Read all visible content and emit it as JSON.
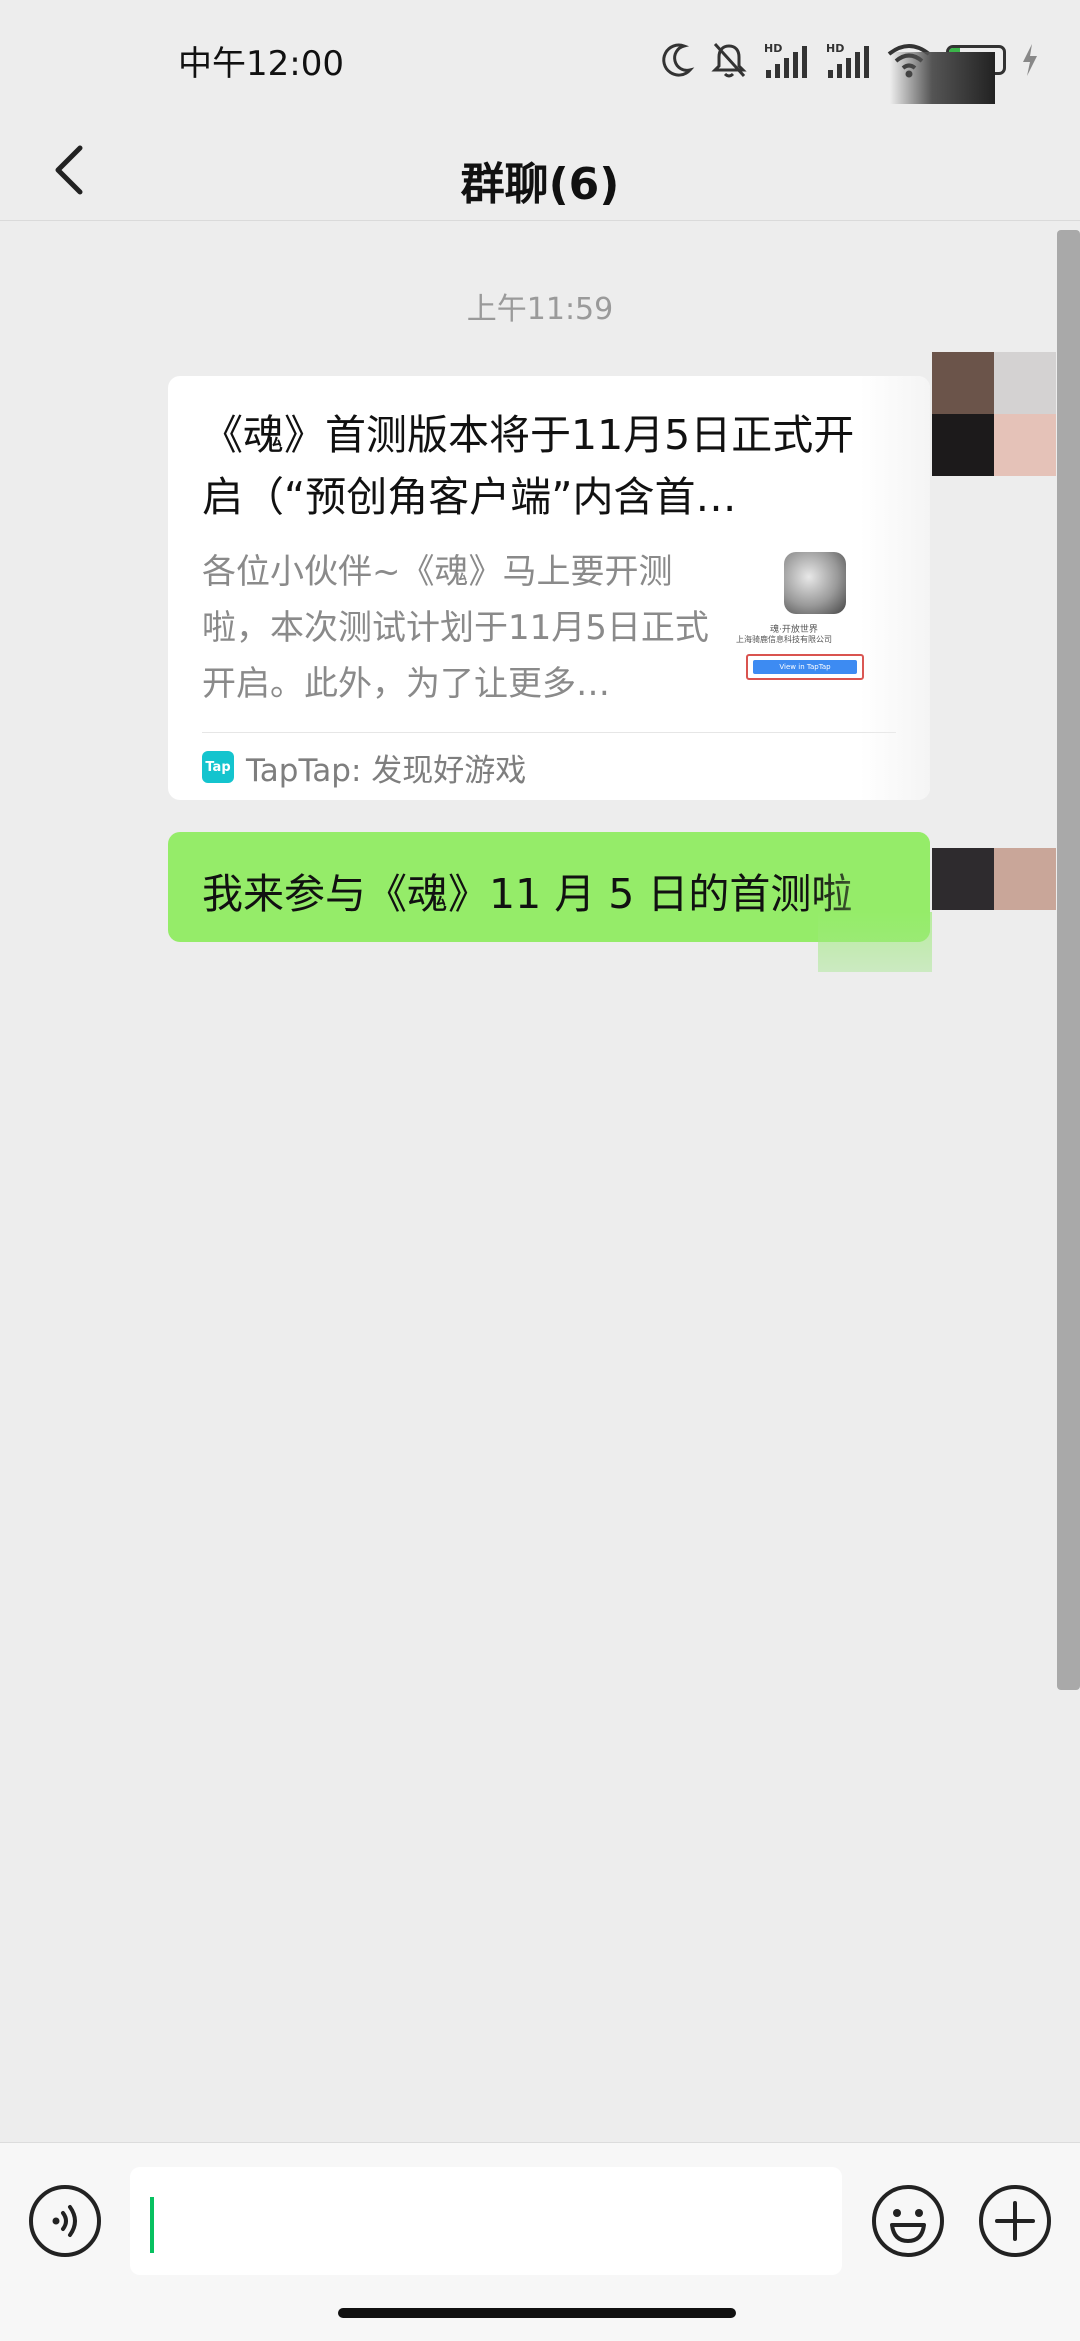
{
  "status_bar": {
    "time": "中午12:00",
    "icons": [
      "moon-icon",
      "bell-off-icon",
      "signal-hd-icon",
      "signal-hd-icon",
      "wifi-icon",
      "battery-icon",
      "charging-bolt-icon"
    ],
    "battery_level": "17",
    "hd_label": "HD"
  },
  "nav": {
    "title": "群聊(6)",
    "back_icon": "chevron-left-icon"
  },
  "chat": {
    "timestamp": "上午11:59",
    "link_card": {
      "title": "《魂》首测版本将于11月5日正式开启（“预创角客户端”内含首…",
      "description": "各位小伙伴~《魂》马上要开测啦，本次测试计划于11月5日正式开启。此外，为了让更多…",
      "thumbnail": {
        "caption": "魂·开放世界",
        "company": "上海骑鹿信息科技有限公司",
        "button": "View in TapTap"
      },
      "source_icon": "Tap",
      "source": "TapTap: 发现好游戏"
    },
    "sent_message": "我来参与《魂》11 月 5 日的首测啦"
  },
  "input_bar": {
    "voice_icon": "voice-icon",
    "emoji_icon": "emoji-icon",
    "add_icon": "plus-icon",
    "input_value": ""
  },
  "colors": {
    "background": "#ededed",
    "sent_bubble": "#95ec69",
    "caret": "#07c160",
    "taptap": "#14c4ce"
  }
}
